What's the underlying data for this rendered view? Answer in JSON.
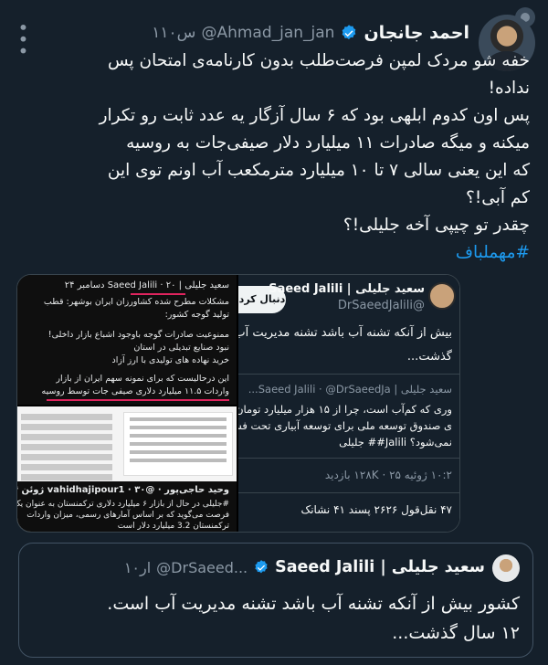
{
  "tweet": {
    "author_name": "احمد جانجان",
    "handle": "@Ahmad_jan_jan",
    "time": "۱۱۰س",
    "text_lines": [
      "خفه شو مردک لمپن فرصت‌طلب بدون کارنامه‌ی امتحان پس",
      "نداده!",
      "پس اون کدوم ابلهی بود که ۶ سال آزگار یه عدد ثابت رو تکرار",
      "میکنه و میگه صادرات ۱۱ میلیارد دلار صیفی‌جات به روسیه",
      "که این یعنی سالی ۷ تا ۱۰ میلیارد مترمکعب آب اونم توی این",
      "کم آبی!؟",
      "چقدر تو چیپی آخه جلیلی!؟"
    ],
    "hashtag": "#مهملباف"
  },
  "media": {
    "top_left": {
      "header": "سعید جلیلی | Saeed Jalili · ۲۰ دسامبر ۲۴",
      "lines": [
        "مشکلات مطرح شده کشاورزان ایران بوشهر: قطب",
        "تولید گوجه کشور:",
        "ممنوعیت صادرات گوجه باوجود اشباع بازار داخلی!",
        "نبود صنایع تبدیلی در استان",
        "خرید نهاده های تولیدی با ارز آزاد",
        "این درحالیست که برای نمونه سهم ایران از بازار",
        "واردات ۱۱.۵ میلیارد دلاری صیفی جات توسط روسیه"
      ]
    },
    "right": {
      "follow": "دنبال کرد",
      "name": "سعید جلیلی | Saeed Jalili",
      "handle": "@DrSaeedJalili",
      "lines": [
        "بیش از آنکه تشنه آب باشد تشنه مدیریت آب",
        "گذشت..."
      ],
      "quoted_header": "سعید جلیلی | Saeed Jalili · @DrSaeedJa...",
      "quoted_lines": [
        "وری که کم‌آب است، چرا از ۱۵ هزار میلیارد تومان سهم",
        "ی صندوق توسعه ملی برای توسعه آبیاری تحت فشار",
        "نمی‌شود؟ Jalili## جلیلی"
      ],
      "views_line": "۱۰:۲ ژوئیه ۲۵ · ۱۲۸K بازدید",
      "stats_line": "۴۷ نقل‌قول  ۲۶۲۶ پسند  ۴۱ نشانک"
    },
    "bottom_left": {
      "author": "وحید حاجی‌پور · @vahidhajipour1 · ۳۰ ژوئن ۲۴",
      "lines": [
        "#جلیلی در حال از بازار ۶ میلیارد دلاری ترکمنستان به عنوان یک",
        "فرصت می‌گوید که بر اساس آمارهای رسمی، میزان واردات",
        "ترکمنستان 3.2 میلیارد دلار است"
      ]
    }
  },
  "quote": {
    "name": "سعید جلیلی | Saeed Jalili",
    "handle": "@DrSaeed...",
    "time": "۱۰ار",
    "text_lines": [
      "کشور بیش از آنکه تشنه آب باشد تشنه مدیریت آب است.",
      "۱۲ سال گذشت..."
    ]
  },
  "colors": {
    "background": "#15202b",
    "accent": "#1d9bf0",
    "muted": "#8b98a5",
    "text": "#f7f9f9"
  }
}
